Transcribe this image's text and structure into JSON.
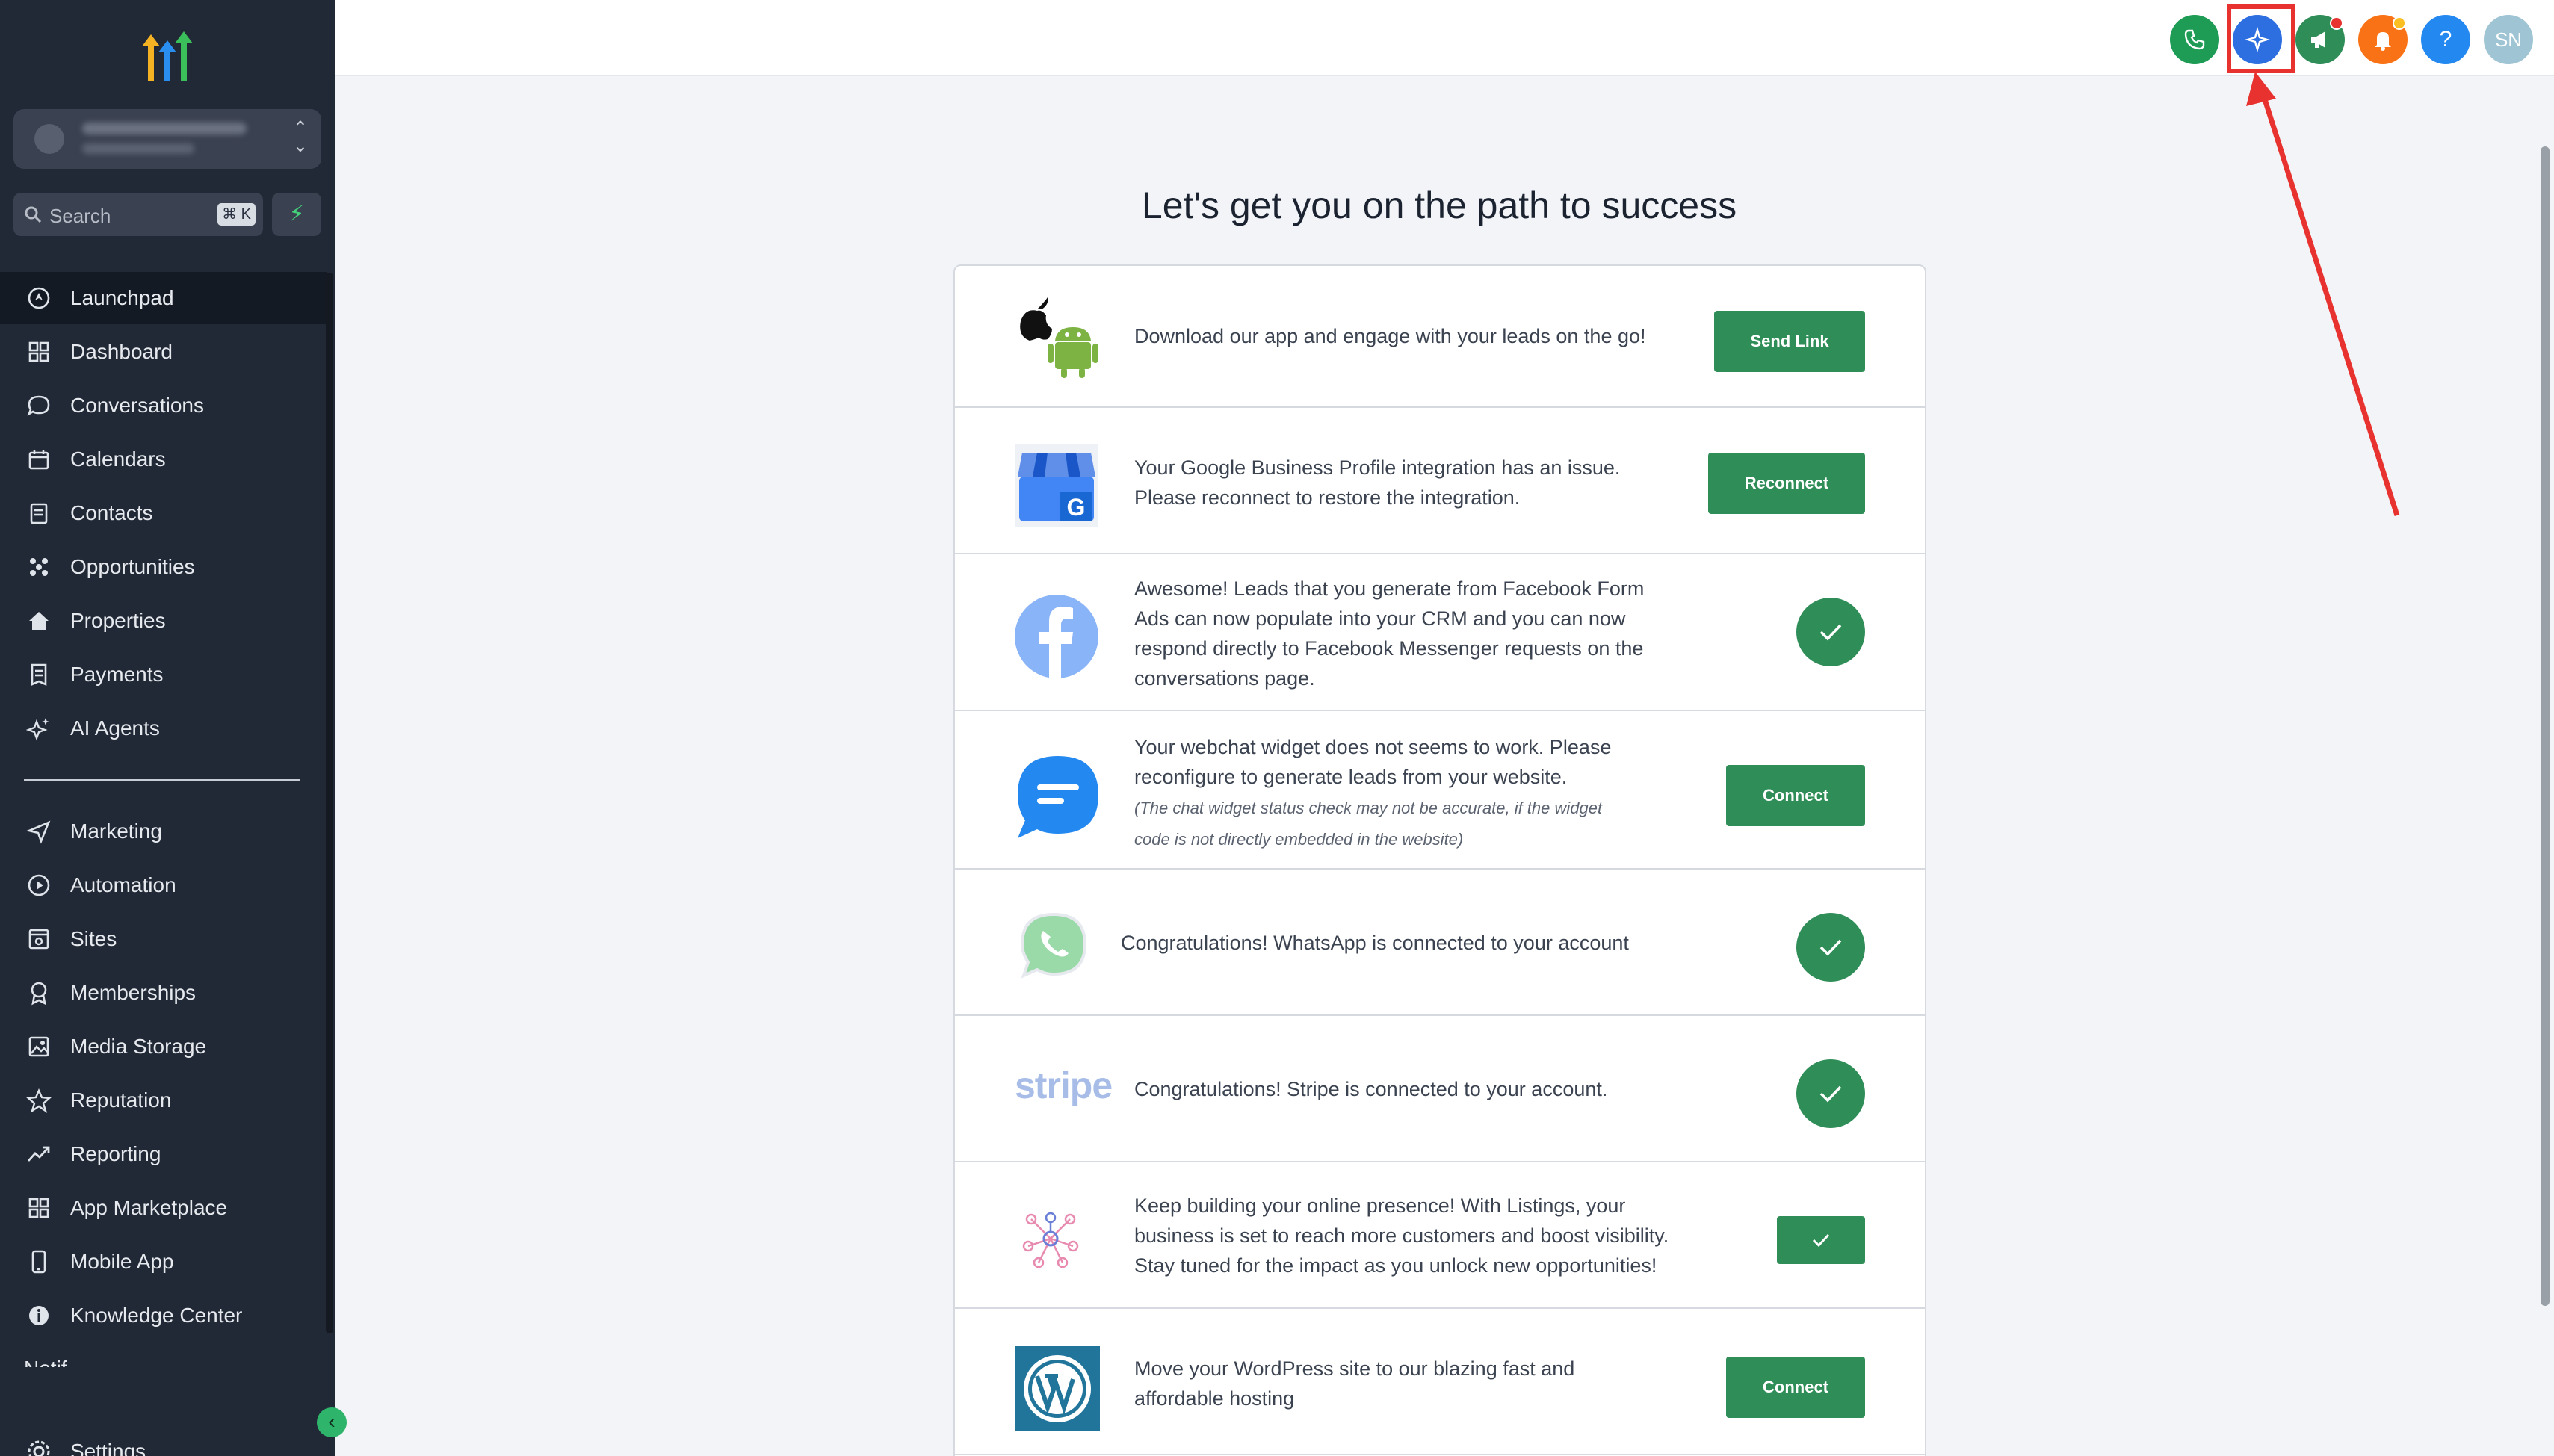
{
  "sidebar": {
    "search_label": "Search",
    "search_shortcut": "⌘ K",
    "items_top": [
      {
        "label": "Launchpad",
        "icon": "launchpad-icon"
      },
      {
        "label": "Dashboard",
        "icon": "dashboard-icon"
      },
      {
        "label": "Conversations",
        "icon": "chat-icon"
      },
      {
        "label": "Calendars",
        "icon": "calendar-icon"
      },
      {
        "label": "Contacts",
        "icon": "contacts-icon"
      },
      {
        "label": "Opportunities",
        "icon": "opportunities-icon"
      },
      {
        "label": "Properties",
        "icon": "home-icon"
      },
      {
        "label": "Payments",
        "icon": "receipt-icon"
      },
      {
        "label": "AI Agents",
        "icon": "sparkle-icon"
      }
    ],
    "items_bottom": [
      {
        "label": "Marketing",
        "icon": "send-icon"
      },
      {
        "label": "Automation",
        "icon": "automation-icon"
      },
      {
        "label": "Sites",
        "icon": "sites-icon"
      },
      {
        "label": "Memberships",
        "icon": "award-icon"
      },
      {
        "label": "Media Storage",
        "icon": "image-icon"
      },
      {
        "label": "Reputation",
        "icon": "star-icon"
      },
      {
        "label": "Reporting",
        "icon": "trend-icon"
      },
      {
        "label": "App Marketplace",
        "icon": "grid-icon"
      },
      {
        "label": "Mobile App",
        "icon": "phone-icon"
      },
      {
        "label": "Knowledge Center",
        "icon": "info-icon"
      }
    ],
    "settings_label": "Settings",
    "cut_label": "Notif"
  },
  "header": {
    "avatar_initials": "SN",
    "help_label": "?"
  },
  "main": {
    "title": "Let's get you on the path to success",
    "rows": [
      {
        "text": "Download our app and engage with your leads on the go!",
        "action": "Send Link"
      },
      {
        "text_lines": [
          "Your Google Business Profile integration has an issue.",
          "Please reconnect to restore the integration."
        ],
        "action": "Reconnect"
      },
      {
        "text_lines": [
          "Awesome! Leads that you generate from Facebook Form",
          "Ads can now populate into your CRM and you can now",
          "respond directly to Facebook Messenger requests on the",
          "conversations page."
        ],
        "status": "connected"
      },
      {
        "text_lines": [
          "Your webchat widget does not seems to work. Please",
          "reconfigure to generate leads from your website."
        ],
        "note_lines": [
          "(The chat widget status check may not be accurate, if the widget",
          "code is not directly embedded in the website)"
        ],
        "action": "Connect"
      },
      {
        "text": "Congratulations! WhatsApp is connected to your account",
        "status": "connected"
      },
      {
        "text": "Congratulations! Stripe is connected to your account.",
        "logo_text": "stripe",
        "status": "connected"
      },
      {
        "text_lines": [
          "Keep building your online presence! With Listings, your",
          "business is set to reach more customers and boost visibility.",
          "Stay tuned for the impact as you unlock new opportunities!"
        ],
        "status": "connected"
      },
      {
        "text_lines": [
          "Move your WordPress site to our blazing fast and",
          "affordable hosting"
        ],
        "action": "Connect"
      }
    ]
  },
  "colors": {
    "sidebar_bg": "#222936",
    "accent_green": "#2f8d57",
    "highlight_red": "#e8322f"
  }
}
